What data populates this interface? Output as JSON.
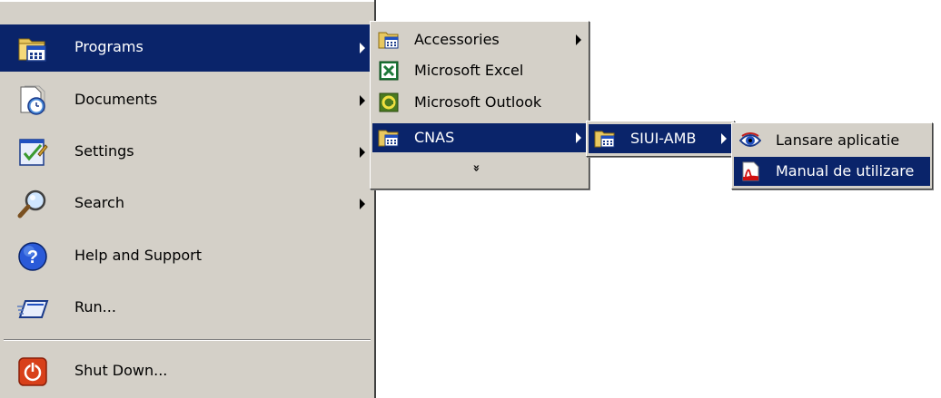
{
  "start_menu": {
    "items": [
      {
        "label": "Programs",
        "icon": "programs-folder-icon"
      },
      {
        "label": "Documents",
        "icon": "documents-icon"
      },
      {
        "label": "Settings",
        "icon": "settings-icon"
      },
      {
        "label": "Search",
        "icon": "search-icon"
      },
      {
        "label": "Help and Support",
        "icon": "help-icon"
      },
      {
        "label": "Run...",
        "icon": "run-icon"
      },
      {
        "label": "Shut Down...",
        "icon": "shutdown-icon"
      }
    ]
  },
  "programs_menu": {
    "items": [
      {
        "label": "Accessories",
        "icon": "program-group-icon"
      },
      {
        "label": "Microsoft Excel",
        "icon": "excel-icon"
      },
      {
        "label": "Microsoft Outlook",
        "icon": "outlook-icon"
      },
      {
        "label": "CNAS",
        "icon": "program-group-icon"
      }
    ],
    "expand_glyph": "»"
  },
  "cnas_menu": {
    "items": [
      {
        "label": "SIUI-AMB",
        "icon": "program-group-icon"
      }
    ]
  },
  "siui_menu": {
    "items": [
      {
        "label": "Lansare aplicatie",
        "icon": "app-eye-icon"
      },
      {
        "label": "Manual de utilizare",
        "icon": "pdf-icon"
      }
    ]
  },
  "colors": {
    "menu_background": "#d4d0c8",
    "selection": "#0a246a",
    "selection_text": "#ffffff"
  }
}
